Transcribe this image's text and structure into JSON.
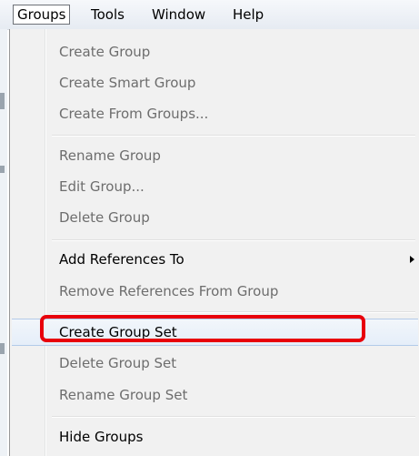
{
  "menubar": {
    "items": [
      {
        "label": "Groups",
        "active": true
      },
      {
        "label": "Tools",
        "active": false
      },
      {
        "label": "Window",
        "active": false
      },
      {
        "label": "Help",
        "active": false
      }
    ]
  },
  "menu": {
    "sections": [
      {
        "items": [
          {
            "label": "Create Group",
            "enabled": false
          },
          {
            "label": "Create Smart Group",
            "enabled": false
          },
          {
            "label": "Create From Groups...",
            "enabled": false
          }
        ]
      },
      {
        "items": [
          {
            "label": "Rename Group",
            "enabled": false
          },
          {
            "label": "Edit Group...",
            "enabled": false
          },
          {
            "label": "Delete Group",
            "enabled": false
          }
        ]
      },
      {
        "items": [
          {
            "label": "Add References To",
            "enabled": true,
            "submenu": true,
            "submenu_icon": "chevron-right-icon"
          },
          {
            "label": "Remove References From Group",
            "enabled": false
          }
        ]
      },
      {
        "items": [
          {
            "label": "Create Group Set",
            "enabled": true,
            "hovered": true,
            "highlighted": true,
            "highlight_color": "#e8000b"
          },
          {
            "label": "Delete Group Set",
            "enabled": false
          },
          {
            "label": "Rename Group Set",
            "enabled": false
          }
        ]
      },
      {
        "items": [
          {
            "label": "Hide Groups",
            "enabled": true
          }
        ]
      }
    ]
  },
  "colors": {
    "disabled_text": "#6d6d6d",
    "enabled_text": "#000000",
    "highlight_border": "#e8000b",
    "hover_border": "#b3cbe9"
  }
}
